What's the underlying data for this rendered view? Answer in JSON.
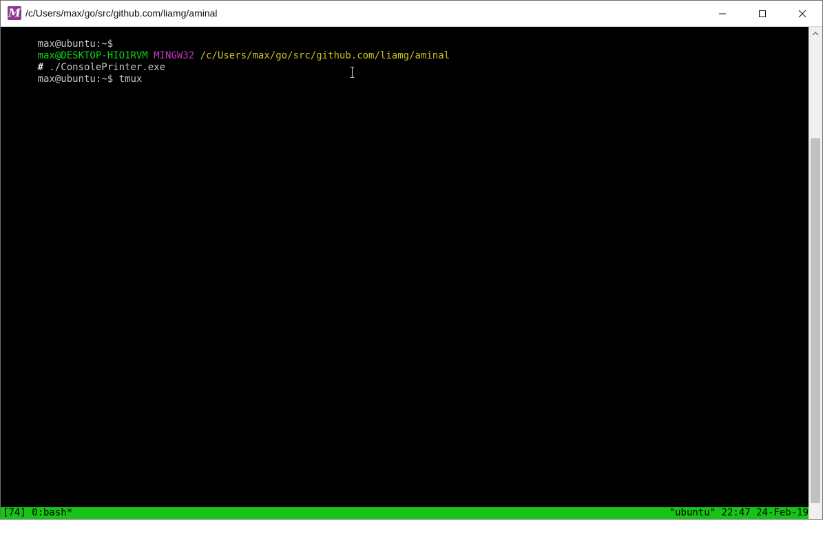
{
  "window": {
    "title": "/c/Users/max/go/src/github.com/liamg/aminal",
    "app_icon": "aminal-m-icon",
    "controls": {
      "minimize": "minimize-icon",
      "maximize": "maximize-icon",
      "close": "close-icon"
    }
  },
  "terminal": {
    "lines": [
      {
        "segments": [
          "max@ubuntu:~$"
        ]
      },
      {
        "segments": [
          "max@DESKTOP-HIO1RVM",
          " ",
          "MINGW32",
          " ",
          "/c/Users/max/go/src/github.com/liamg/aminal"
        ]
      },
      {
        "segments": [
          "#",
          " ./ConsolePrinter.exe"
        ]
      },
      {
        "segments": [
          "max@ubuntu:~$ ",
          "tmux"
        ]
      }
    ],
    "colors": {
      "background": "#000000",
      "text": "#c7c7c7",
      "user_host": "#13d313",
      "mingw": "#c33ac3",
      "path": "#c7c427",
      "status_bar": "#16c316"
    }
  },
  "status_bar": {
    "left": "[74] 0:bash*",
    "right": "\"ubuntu\" 22:47 24-Feb-19"
  },
  "cursor": "text-ibeam-cursor-icon"
}
